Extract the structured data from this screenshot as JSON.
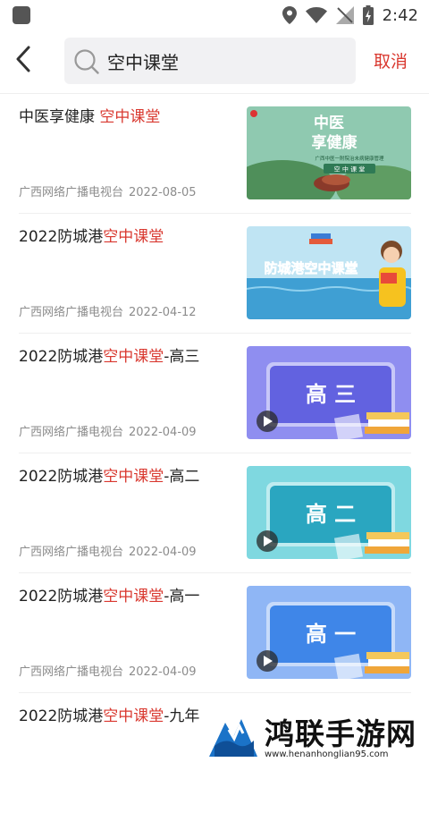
{
  "status_bar": {
    "time": "2:42",
    "icons": [
      "app-icon",
      "location-icon",
      "wifi-icon",
      "signal-icon",
      "battery-icon"
    ]
  },
  "search": {
    "value": "空中课堂",
    "cancel_label": "取消"
  },
  "results": [
    {
      "title_before": "中医享健康 ",
      "title_highlight": "空中课堂",
      "title_after": "",
      "source": "广西网络广播电视台",
      "date": "2022-08-05",
      "thumbnail": {
        "kind": "tcm",
        "heading_line1": "中医",
        "heading_line2": "享健康",
        "subtitle": "广西中医一附院治未病健康管理",
        "caption": "空 中 课 堂"
      }
    },
    {
      "title_before": "2022防城港",
      "title_highlight": "空中课堂",
      "title_after": "",
      "source": "广西网络广播电视台",
      "date": "2022-04-12",
      "thumbnail": {
        "kind": "sea",
        "banner": "防城港空中课堂"
      }
    },
    {
      "title_before": "2022防城港",
      "title_highlight": "空中课堂",
      "title_after": "-高三",
      "source": "广西网络广播电视台",
      "date": "2022-04-09",
      "thumbnail": {
        "kind": "board",
        "board_text": "高 三",
        "bg": "#8f8ef0",
        "board": "#6262e0"
      }
    },
    {
      "title_before": "2022防城港",
      "title_highlight": "空中课堂",
      "title_after": "-高二",
      "source": "广西网络广播电视台",
      "date": "2022-04-09",
      "thumbnail": {
        "kind": "board",
        "board_text": "高 二",
        "bg": "#7fd8e0",
        "board": "#2aa6c0"
      }
    },
    {
      "title_before": "2022防城港",
      "title_highlight": "空中课堂",
      "title_after": "-高一",
      "source": "广西网络广播电视台",
      "date": "2022-04-09",
      "thumbnail": {
        "kind": "board",
        "board_text": "高 一",
        "bg": "#8fb6f5",
        "board": "#3f86e8"
      }
    },
    {
      "title_before": "2022防城港",
      "title_highlight": "空中课堂",
      "title_after": "-九年",
      "source": "",
      "date": "",
      "thumbnail": null
    }
  ],
  "watermark": {
    "title": "鸿联手游网",
    "url": "www.henanhonglian95.com"
  },
  "colors": {
    "accent": "#d9382f",
    "meta": "#8c8c8c",
    "search_bg": "#f1f1f3"
  }
}
